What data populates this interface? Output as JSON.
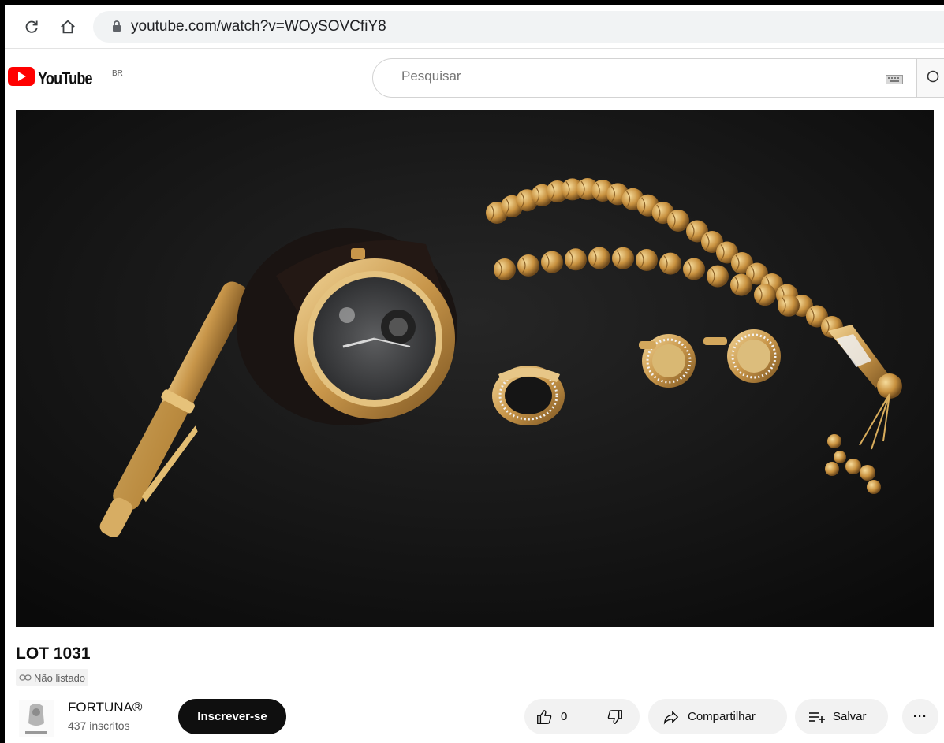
{
  "browser": {
    "url": "youtube.com/watch?v=WOySOVCfiY8"
  },
  "header": {
    "logo_text": "YouTube",
    "country_code": "BR",
    "search_placeholder": "Pesquisar"
  },
  "video": {
    "title": "LOT 1031",
    "visibility_label": "Não listado"
  },
  "channel": {
    "name": "FORTUNA®",
    "subscribers": "437 inscritos",
    "subscribe_label": "Inscrever-se"
  },
  "actions": {
    "like_count": "0",
    "share_label": "Compartilhar",
    "save_label": "Salvar",
    "more_label": "···"
  },
  "colors": {
    "brand_red": "#ff0000",
    "subscribe_bg": "#0f0f0f",
    "pill_bg": "#f2f2f2",
    "gold": "#c89a4a"
  }
}
